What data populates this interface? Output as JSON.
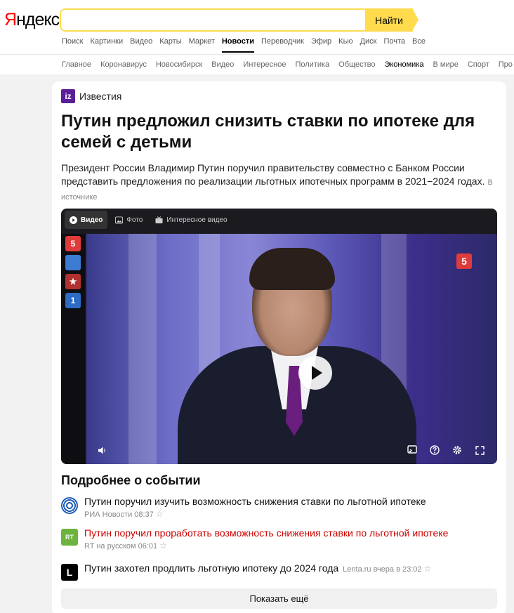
{
  "header": {
    "logo_first": "Я",
    "logo_rest": "ндекс",
    "search_value": "",
    "search_button": "Найти",
    "services": [
      "Поиск",
      "Картинки",
      "Видео",
      "Карты",
      "Маркет",
      "Новости",
      "Переводчик",
      "Эфир",
      "Кью",
      "Диск",
      "Почта",
      "Все"
    ],
    "active_service": "Новости"
  },
  "rubrics": [
    "Главное",
    "Коронавирус",
    "Новосибирск",
    "Видео",
    "Интересное",
    "Политика",
    "Общество",
    "Экономика",
    "В мире",
    "Спорт",
    "Про"
  ],
  "active_rubric": "Экономика",
  "article": {
    "source_logo": "iz",
    "source_name": "Известия",
    "title": "Путин предложил снизить ставки по ипотеке для семей с детьми",
    "lead": "Президент России Владимир Путин поручил правительству совместно с Банком России представить предложения по реализации льготных ипотечных программ в 2021−2024 годах.",
    "in_source": "В источнике"
  },
  "player": {
    "tabs": [
      {
        "label": "Видео",
        "icon": "play-circle-icon"
      },
      {
        "label": "Фото",
        "icon": "image-icon"
      },
      {
        "label": "Интересное видео",
        "icon": "tv-icon"
      }
    ],
    "channels": [
      "5",
      "",
      "★",
      "1"
    ],
    "corner_logo": "5"
  },
  "more": {
    "title": "Подробнее о событии",
    "items": [
      {
        "title": "Путин поручил изучить возможность снижения ставки по льготной ипотеке",
        "meta": "РИА Новости 08:37",
        "icon": "ria-logo-icon"
      },
      {
        "title": "Путин поручил проработать возможность снижения ставки по льготной ипотеке",
        "meta": "RT на русском 06:01",
        "icon": "rt-logo-icon",
        "icon_text": "RT"
      },
      {
        "title": "Путин захотел продлить льготную ипотеку до 2024 года",
        "meta": "Lenta.ru вчера в 23:02",
        "icon": "lenta-logo-icon",
        "icon_text": "L"
      }
    ],
    "show_more": "Показать ещё"
  },
  "colors": {
    "accent": "#ffdb4d",
    "logo_red": "#ff0000",
    "izvestia": "#5a1e99",
    "rt_green": "#6cb33f",
    "link_red": "#cc0000"
  }
}
